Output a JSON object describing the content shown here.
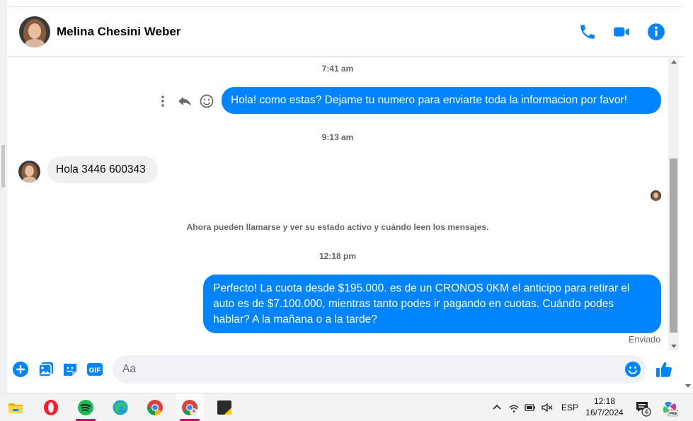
{
  "contact": {
    "name": "Melina Chesini Weber"
  },
  "messages": {
    "time_1": "7:41 am",
    "outgoing_1": "Hola! como estas? Dejame tu numero para enviarte toda la informacion por favor!",
    "time_2": "9:13 am",
    "incoming_1": "Hola 3446 600343",
    "system_notice": "Ahora pueden llamarse y ver su estado activo y cuándo leen los mensajes.",
    "time_3": "12:18 pm",
    "outgoing_2": "Perfecto! La cuota desde $195.000. es de un CRONOS 0KM el anticipo para retirar el auto es de $7.100.000, mientras tanto podes ir pagando en cuotas. Cuándo podes hablar? A la mañana o a la tarde?",
    "status": "Enviado"
  },
  "composer": {
    "placeholder": "Aa",
    "gif_label": "GIF"
  },
  "taskbar": {
    "apps": [
      "file-explorer",
      "opera",
      "spotify",
      "edge",
      "chrome",
      "chrome-profile",
      "sticky-notes"
    ],
    "language": "ESP",
    "time": "12:18",
    "date": "16/7/2024",
    "notification_count": "4",
    "copilot_badge": "PRE"
  },
  "colors": {
    "accent": "#0084ff",
    "bubble_in": "#f0f0f0",
    "muted": "#65676b"
  }
}
